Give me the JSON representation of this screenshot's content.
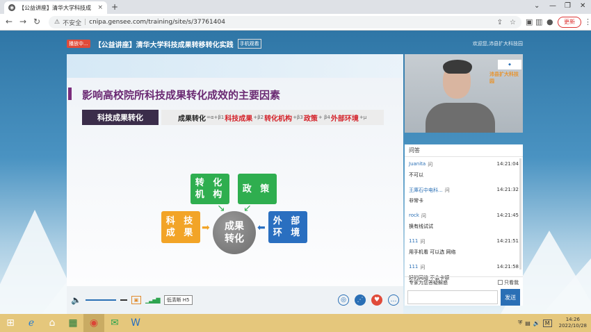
{
  "browser": {
    "tab_title": "【公益讲座】清华大学科技成",
    "tab_close": "×",
    "new_tab": "+",
    "security_label": "不安全",
    "url": "cnipa.gensee.com/training/site/s/37761404",
    "update_label": "更新"
  },
  "page": {
    "live_badge": "播放中...",
    "course_title": "【公益讲座】清华大学科技成果转移转化实践",
    "mobile_view": "手机观看",
    "welcome": "欢迎您,沛县扩大科技园"
  },
  "slide": {
    "title": "影响高校院所科技成果转化成效的主要因素",
    "label": "科技成果转化",
    "formula": {
      "p1": "成果转化",
      "p2": "=α+β1",
      "p3": "科技成果",
      "p4": "+β2",
      "p5": "转化机构",
      "p6": "+β3",
      "p7": "政策",
      "p8": "+ β4",
      "p9": "外部环境",
      "p10": "+μ"
    },
    "boxes": {
      "zhuanhua_l1": "转 化",
      "zhuanhua_l2": "机 构",
      "zhengce": "政 策",
      "keji_l1": "科 技",
      "keji_l2": "成 果",
      "waibu_l1": "外 部",
      "waibu_l2": "环 境",
      "center_l1": "成果",
      "center_l2": "转化"
    },
    "colors": {
      "green": "#2fae4f",
      "orange": "#f2a427",
      "blue": "#2a6fc0",
      "title_purple": "#6b2a73"
    }
  },
  "player": {
    "volume_icon": "speaker-icon",
    "quality": "低清晰 H5"
  },
  "video": {
    "org_label": "沛县扩大科技园"
  },
  "qa": {
    "header": "问答",
    "tag": "问",
    "items": [
      {
        "user": "Juanita",
        "time": "14:21:04",
        "text": "不可以"
      },
      {
        "user": "王庫石中电科...",
        "time": "14:21:32",
        "text": "非常卡"
      },
      {
        "user": "rock",
        "time": "14:21:45",
        "text": "换有线试试"
      },
      {
        "user": "111",
        "time": "14:21:51",
        "text": "用手机看 可以选 网络"
      },
      {
        "user": "111",
        "time": "14:21:58",
        "text": "好的网络 不会卡顿"
      }
    ],
    "footer_text": "专家为您答疑解惑",
    "only_mine": "只看我",
    "send": "发送"
  },
  "taskbar": {
    "time": "14:26",
    "date": "2022/10/28",
    "ime": "M"
  }
}
